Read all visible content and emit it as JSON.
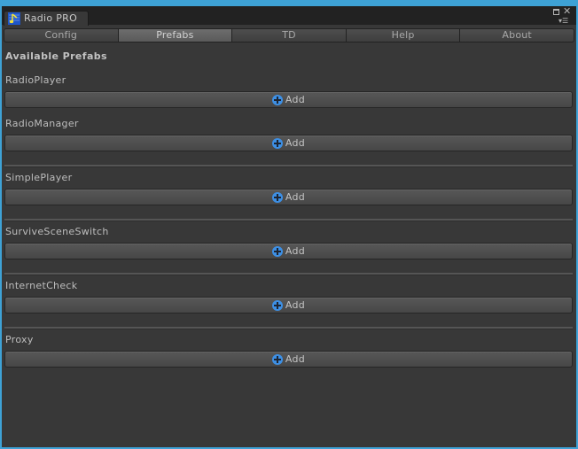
{
  "window": {
    "tab_title": "Radio PRO",
    "tab_icon": "radio-music-note-icon",
    "controls": {
      "maximize": "maximize-icon",
      "close": "close-icon",
      "menu": "context-menu-icon"
    }
  },
  "toolbar": {
    "tabs": [
      {
        "label": "Config",
        "active": false
      },
      {
        "label": "Prefabs",
        "active": true
      },
      {
        "label": "TD",
        "active": false
      },
      {
        "label": "Help",
        "active": false
      },
      {
        "label": "About",
        "active": false
      }
    ]
  },
  "main": {
    "heading": "Available Prefabs",
    "add_icon": "plus-circle-icon",
    "prefabs": [
      {
        "name": "RadioPlayer",
        "button_label": "Add"
      },
      {
        "name": "RadioManager",
        "button_label": "Add"
      },
      {
        "name": "SimplePlayer",
        "button_label": "Add"
      },
      {
        "name": "SurviveSceneSwitch",
        "button_label": "Add"
      },
      {
        "name": "InternetCheck",
        "button_label": "Add"
      },
      {
        "name": "Proxy",
        "button_label": "Add"
      }
    ]
  },
  "colors": {
    "accent": "#3d8fe4",
    "window_border": "#3ea2d6",
    "background": "#383838"
  }
}
